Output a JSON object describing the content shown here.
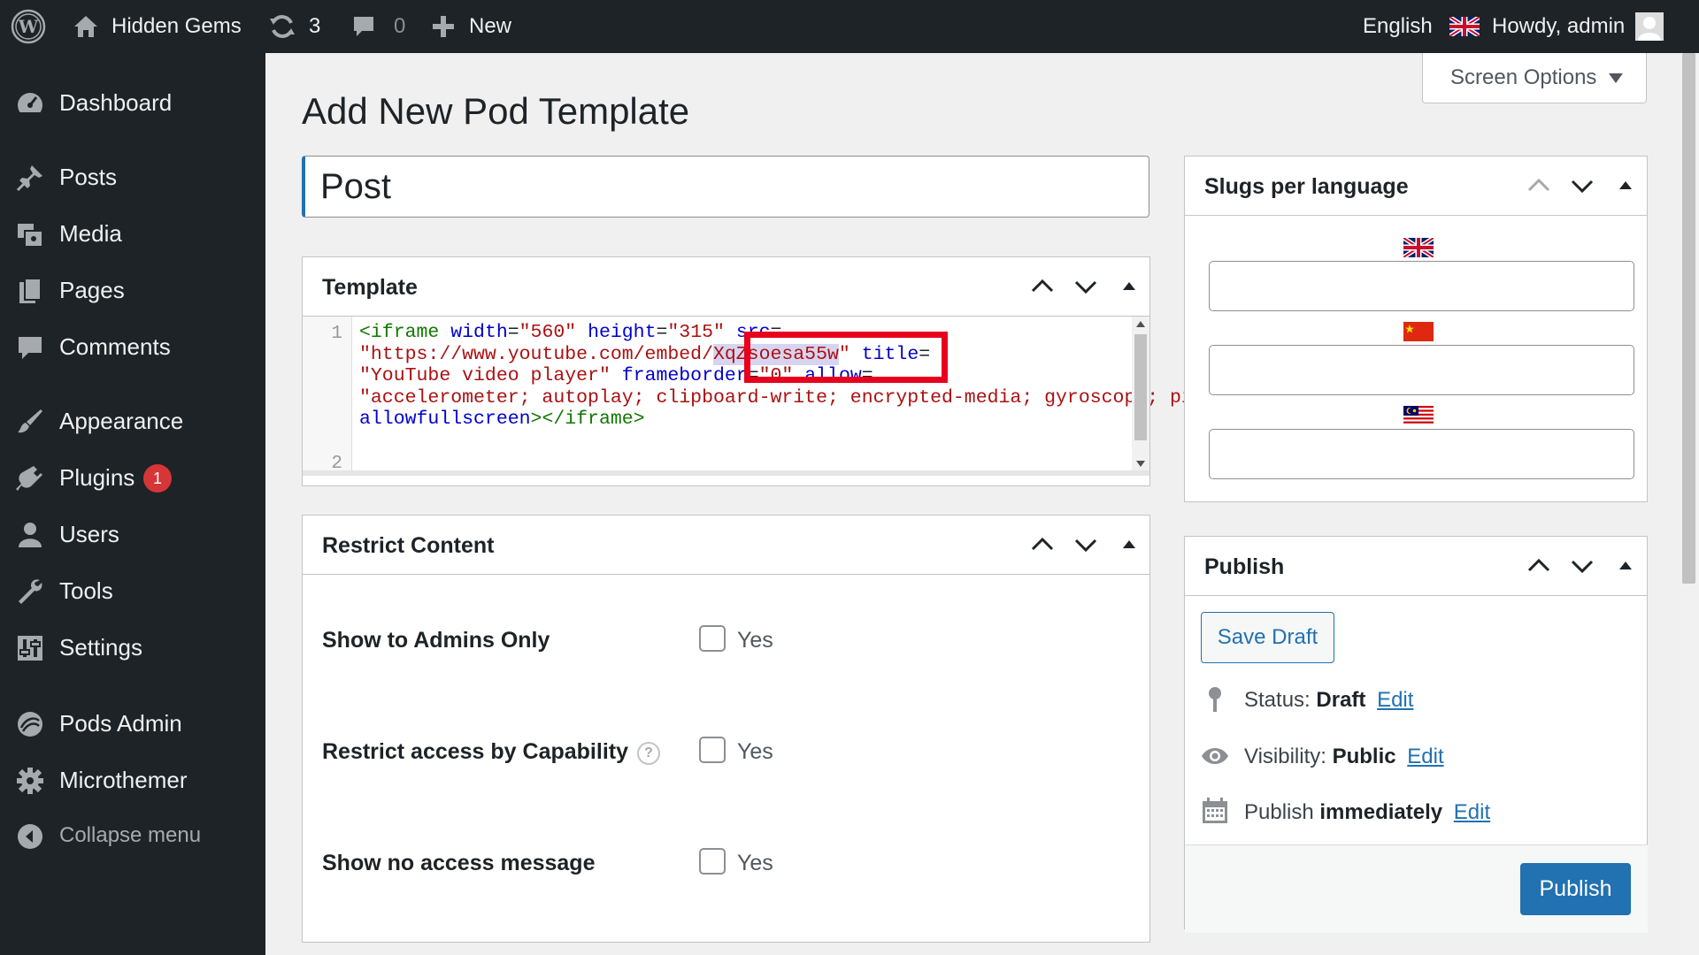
{
  "admin_bar": {
    "site_name": "Hidden Gems",
    "updates_count": "3",
    "comments_count": "0",
    "new_label": "New",
    "language": "English",
    "greeting": "Howdy, admin"
  },
  "sidebar": {
    "items": [
      {
        "label": "Dashboard",
        "icon": "dashboard-icon"
      },
      {
        "label": "Posts",
        "icon": "pushpin-icon"
      },
      {
        "label": "Media",
        "icon": "media-icon"
      },
      {
        "label": "Pages",
        "icon": "pages-icon"
      },
      {
        "label": "Comments",
        "icon": "comment-icon"
      },
      {
        "label": "Appearance",
        "icon": "paintbrush-icon"
      },
      {
        "label": "Plugins",
        "icon": "plugin-icon",
        "badge": "1"
      },
      {
        "label": "Users",
        "icon": "users-icon"
      },
      {
        "label": "Tools",
        "icon": "wrench-icon"
      },
      {
        "label": "Settings",
        "icon": "settings-icon"
      },
      {
        "label": "Pods Admin",
        "icon": "pods-icon"
      },
      {
        "label": "Microthemer",
        "icon": "gear-icon"
      },
      {
        "label": "Collapse menu",
        "icon": "collapse-icon"
      }
    ]
  },
  "screen_options_label": "Screen Options",
  "page_title": "Add New Pod Template",
  "title_value": "Post",
  "template_box": {
    "title": "Template",
    "line_numbers": [
      "1",
      "2"
    ],
    "code": "<iframe width=\"560\" height=\"315\" src=\"https://www.youtube.com/embed/XqZsoesa55w\" title=\"YouTube video player\" frameborder=\"0\" allow=\"accelerometer; autoplay; clipboard-write; encrypted-media; gyroscope; picture-in-picture; web-share\" allowfullscreen></iframe>",
    "highlighted_text": "XqZsoesa55w"
  },
  "restrict_box": {
    "title": "Restrict Content",
    "rows": [
      {
        "label": "Show to Admins Only",
        "option": "Yes",
        "checked": false,
        "help": false
      },
      {
        "label": "Restrict access by Capability",
        "option": "Yes",
        "checked": false,
        "help": true,
        "help_glyph": "?"
      },
      {
        "label": "Show no access message",
        "option": "Yes",
        "checked": false,
        "help": false
      }
    ]
  },
  "slugs_box": {
    "title": "Slugs per language",
    "languages": [
      {
        "flag": "uk-flag-icon",
        "value": ""
      },
      {
        "flag": "china-flag-icon",
        "value": ""
      },
      {
        "flag": "malaysia-flag-icon",
        "value": ""
      }
    ]
  },
  "publish_box": {
    "title": "Publish",
    "save_draft_label": "Save Draft",
    "status_label": "Status:",
    "status_value": "Draft",
    "visibility_label": "Visibility:",
    "visibility_value": "Public",
    "schedule_label": "Publish",
    "schedule_value": "immediately",
    "edit_label": "Edit",
    "publish_label": "Publish"
  },
  "colors": {
    "admin_bar_bg": "#1d2327",
    "accent": "#2271b1",
    "badge": "#d63638",
    "highlight_box": "#e8001d"
  }
}
